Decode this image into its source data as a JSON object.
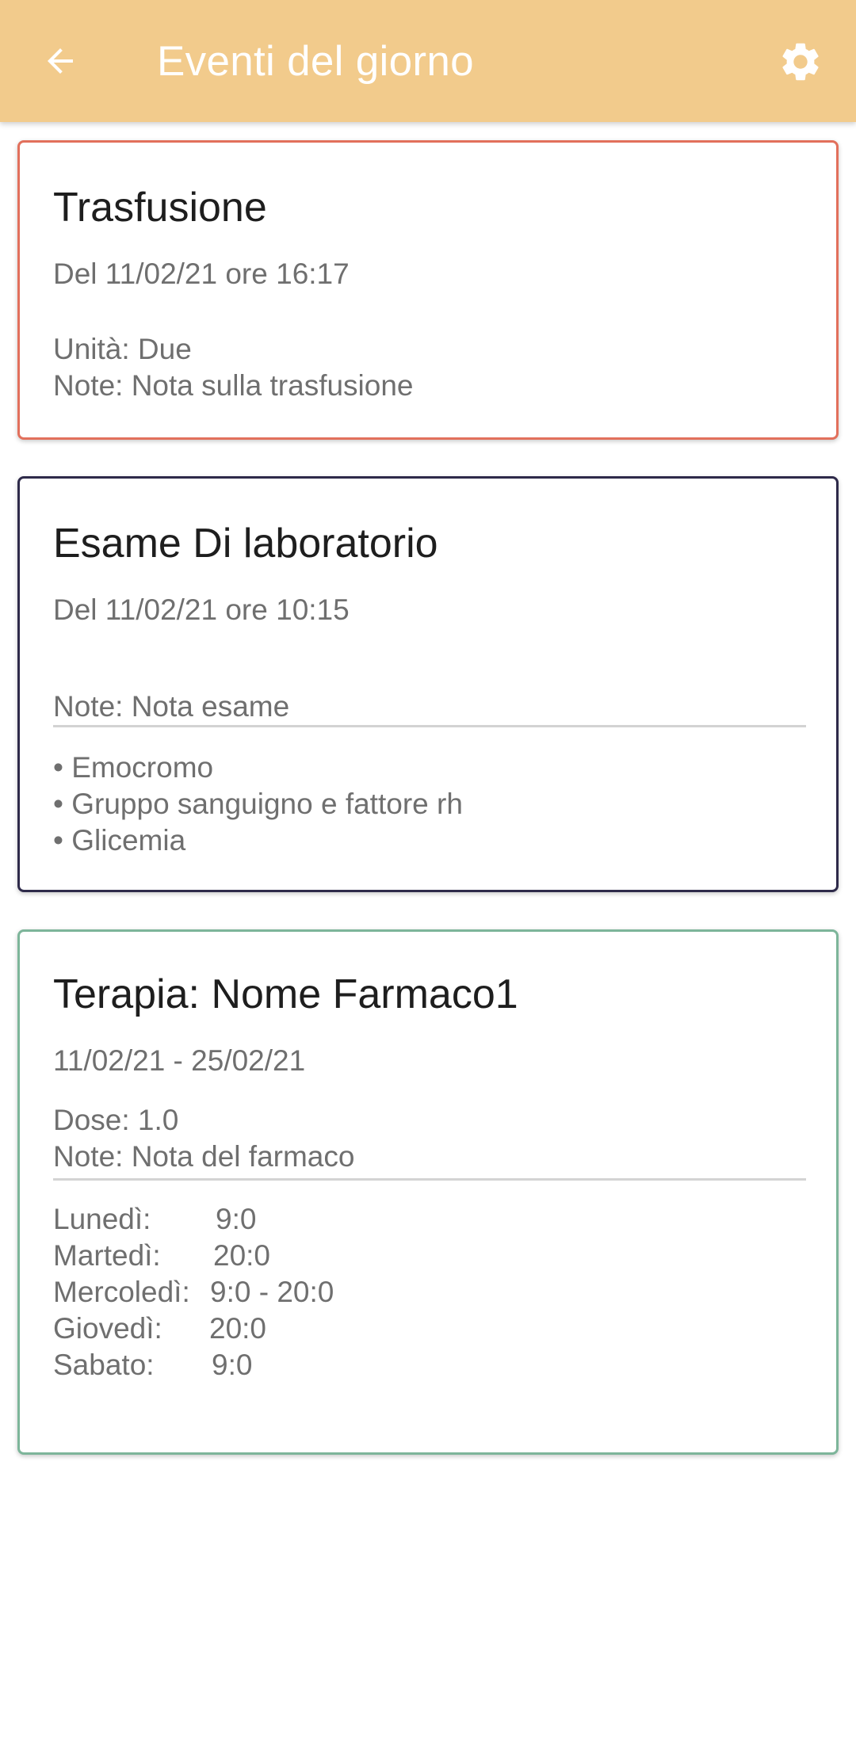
{
  "appbar": {
    "title": "Eventi del giorno",
    "back_icon": "arrow-back-icon",
    "settings_icon": "gear-icon",
    "background_color": "#F2CB8C"
  },
  "cards": {
    "transfusion": {
      "border_color": "#E2705C",
      "title": "Trasfusione",
      "date": "Del 11/02/21 ore 16:17",
      "units": "Unità: Due",
      "note": "Note: Nota sulla trasfusione"
    },
    "lab_exam": {
      "border_color": "#2E2A4A",
      "title": "Esame Di laboratorio",
      "date": "Del 11/02/21 ore 10:15",
      "note": "Note: Nota esame",
      "tests": [
        "• Emocromo",
        "• Gruppo sanguigno e fattore rh",
        "• Glicemia"
      ]
    },
    "therapy": {
      "border_color": "#7DB59A",
      "title": "Terapia: Nome Farmaco1",
      "period": "11/02/21 - 25/02/21",
      "dose": "Dose: 1.0",
      "note": "Note: Nota del farmaco",
      "schedule": [
        {
          "day": "Lunedì:",
          "times": "9:0"
        },
        {
          "day": "Martedì:",
          "times": "20:0"
        },
        {
          "day": "Mercoledì:",
          "times": "9:0 - 20:0"
        },
        {
          "day": "Giovedì:",
          "times": "20:0"
        },
        {
          "day": "Sabato:",
          "times": "9:0"
        }
      ]
    }
  }
}
